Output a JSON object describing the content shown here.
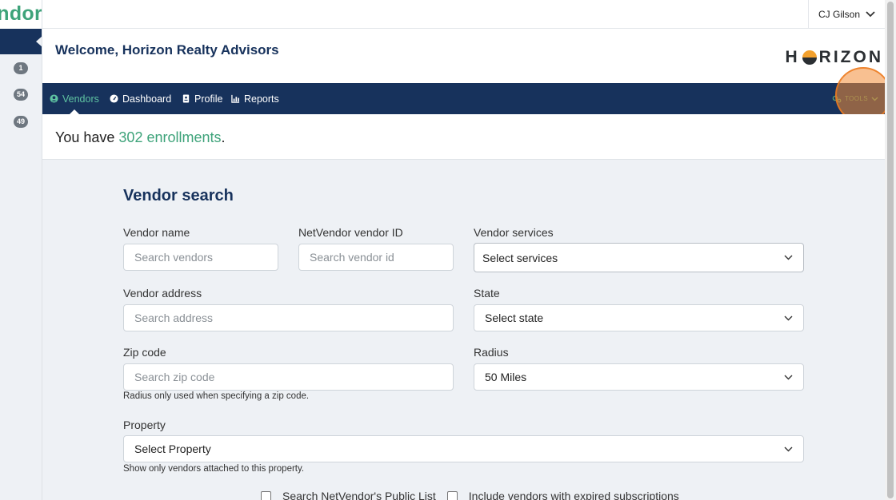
{
  "brand": {
    "text": "ndor"
  },
  "sidebar": {
    "badges": [
      "1",
      "54",
      "49"
    ]
  },
  "user": {
    "name": "CJ Gilson"
  },
  "header": {
    "welcome": "Welcome, Horizon Realty Advisors",
    "logo_left": "H",
    "logo_right": "RIZON"
  },
  "nav": {
    "items": [
      {
        "label": "Vendors",
        "icon": "user-circle-icon",
        "active": true
      },
      {
        "label": "Dashboard",
        "icon": "gauge-icon"
      },
      {
        "label": "Profile",
        "icon": "id-card-icon"
      },
      {
        "label": "Reports",
        "icon": "chart-icon"
      }
    ],
    "tools": "TOOLS"
  },
  "enrollments": {
    "prefix": "You have ",
    "count": "302 enrollments",
    "suffix": "."
  },
  "search": {
    "title": "Vendor search",
    "vendor_name": {
      "label": "Vendor name",
      "placeholder": "Search vendors"
    },
    "vendor_id": {
      "label": "NetVendor vendor ID",
      "placeholder": "Search vendor id"
    },
    "services": {
      "label": "Vendor services",
      "value": "Select services"
    },
    "address": {
      "label": "Vendor address",
      "placeholder": "Search address"
    },
    "state": {
      "label": "State",
      "value": "Select state"
    },
    "zip": {
      "label": "Zip code",
      "placeholder": "Search zip code",
      "help": "Radius only used when specifying a zip code."
    },
    "radius": {
      "label": "Radius",
      "value": "50 Miles"
    },
    "property": {
      "label": "Property",
      "value": "Select Property",
      "help": "Show only vendors attached to this property."
    },
    "public_list": "Search NetVendor's Public List",
    "expired": "Include vendors with expired subscriptions"
  },
  "colors": {
    "navy": "#17325c",
    "accent": "#3ea37a",
    "highlight": "#f28c37"
  }
}
